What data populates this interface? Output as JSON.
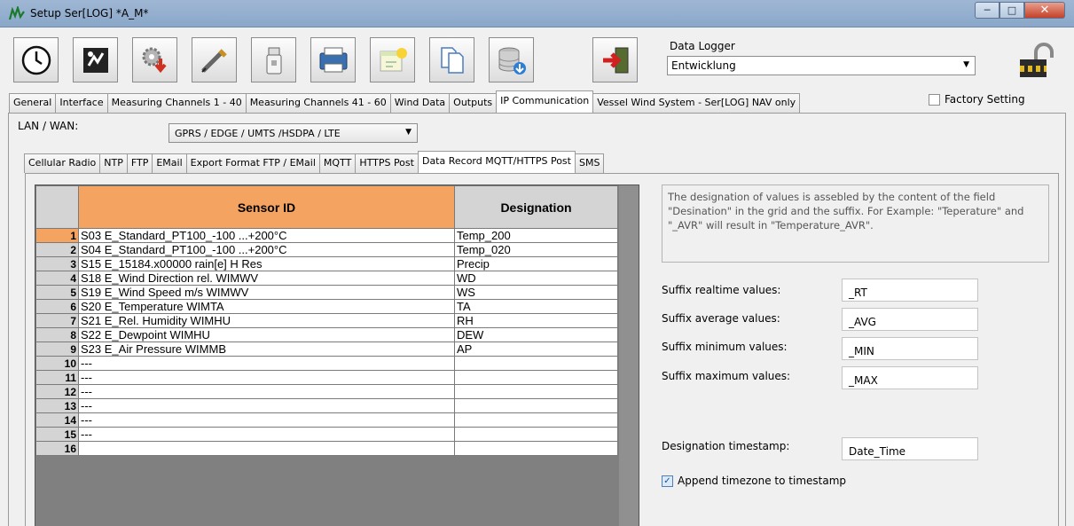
{
  "window": {
    "title": "Setup Ser[LOG]  *A_M*"
  },
  "toolbar": {
    "buttons": [
      "clock-icon",
      "config-icon",
      "gear-download-icon",
      "probe-icon",
      "usb-stick-icon",
      "printer-icon",
      "schedule-icon",
      "copy-icon",
      "database-icon",
      "exit-door-icon"
    ],
    "logger_label": "Data Logger",
    "logger_value": "Entwicklung"
  },
  "tabs": [
    "General",
    "Interface",
    "Measuring Channels 1 - 40",
    "Measuring Channels 41 - 60",
    "Wind Data",
    "Outputs",
    "IP Communication",
    "Vessel Wind System - Ser[LOG] NAV only"
  ],
  "active_tab": "IP Communication",
  "factory_setting": "Factory Setting",
  "lan": {
    "label": "LAN / WAN:",
    "value": "GPRS / EDGE / UMTS /HSDPA / LTE"
  },
  "subtabs": [
    "Cellular Radio",
    "NTP",
    "FTP",
    "EMail",
    "Export Format FTP / EMail",
    "MQTT",
    "HTTPS Post",
    "Data Record MQTT/HTTPS Post",
    "SMS"
  ],
  "active_subtab": "Data Record MQTT/HTTPS Post",
  "grid": {
    "headers": {
      "sensor": "Sensor ID",
      "designation": "Designation"
    },
    "rows": [
      {
        "n": "1",
        "sensor": "S03  E_Standard_PT100_-100 ...+200°C",
        "designation": "Temp_200"
      },
      {
        "n": "2",
        "sensor": "S04  E_Standard_PT100_-100 ...+200°C",
        "designation": "Temp_020"
      },
      {
        "n": "3",
        "sensor": "S15  E_15184.x00000 rain[e]  H Res",
        "designation": "Precip"
      },
      {
        "n": "4",
        "sensor": "S18  E_Wind Direction  rel. WIMWV",
        "designation": "WD"
      },
      {
        "n": "5",
        "sensor": "S19  E_Wind Speed  m/s  WIMWV",
        "designation": "WS"
      },
      {
        "n": "6",
        "sensor": "S20  E_Temperature  WIMTA",
        "designation": "TA"
      },
      {
        "n": "7",
        "sensor": "S21  E_Rel. Humidity  WIMHU",
        "designation": "RH"
      },
      {
        "n": "8",
        "sensor": "S22  E_Dewpoint  WIMHU",
        "designation": "DEW"
      },
      {
        "n": "9",
        "sensor": "S23  E_Air Pressure  WIMMB",
        "designation": "AP"
      },
      {
        "n": "10",
        "sensor": "---",
        "designation": ""
      },
      {
        "n": "11",
        "sensor": "---",
        "designation": ""
      },
      {
        "n": "12",
        "sensor": "---",
        "designation": ""
      },
      {
        "n": "13",
        "sensor": "---",
        "designation": ""
      },
      {
        "n": "14",
        "sensor": "---",
        "designation": ""
      },
      {
        "n": "15",
        "sensor": "---",
        "designation": ""
      },
      {
        "n": "16",
        "sensor": "",
        "designation": ""
      }
    ]
  },
  "description": "The designation of values is assebled by the content of the field \"Desination\" in the grid and the suffix. For Example: \"Teperature\" and \"_AVR\" will result in \"Temperature_AVR\".",
  "fields": {
    "realtime": {
      "label": "Suffix realtime values:",
      "value": "_RT"
    },
    "average": {
      "label": "Suffix average values:",
      "value": "_AVG"
    },
    "minimum": {
      "label": "Suffix minimum values:",
      "value": "_MIN"
    },
    "maximum": {
      "label": "Suffix maximum values:",
      "value": "_MAX"
    },
    "timestamp": {
      "label": "Designation timestamp:",
      "value": "Date_Time"
    }
  },
  "append_timezone": {
    "label": "Append timezone to timestamp",
    "checked": true
  },
  "colors": {
    "header_orange": "#f4a460",
    "titlebar": "#9fb7d4"
  }
}
